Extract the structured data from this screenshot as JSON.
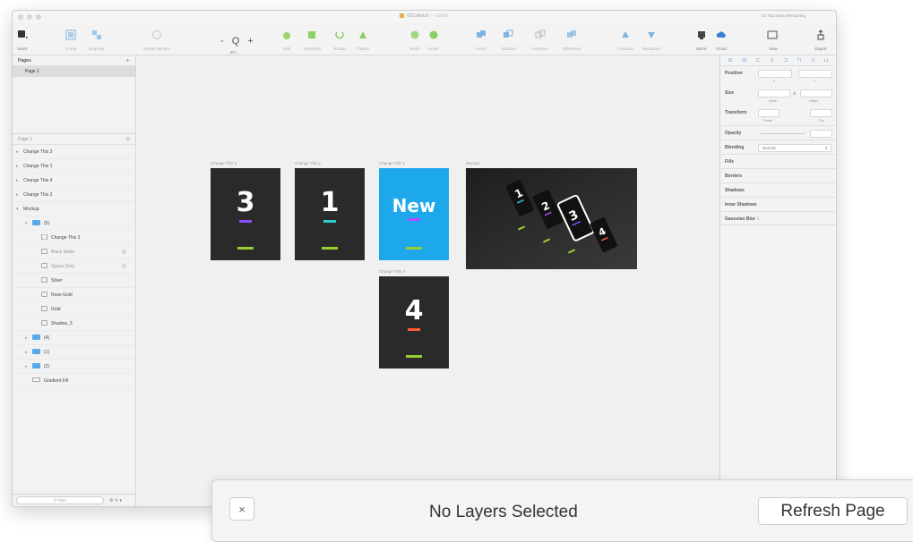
{
  "window": {
    "title": "003.sketch",
    "title_suffix": "— Edited",
    "trial_text": "24 Trial Days Remaining"
  },
  "toolbar": {
    "insert": "Insert",
    "group": "Group",
    "ungroup": "Ungroup",
    "create_symbol": "Create Symbol",
    "zoom_symbol": "- Q +",
    "zoom_value": "8%",
    "edit": "Edit",
    "transform": "Transform",
    "rotate": "Rotate",
    "flatten": "Flatten",
    "mask": "Mask",
    "scale": "Scale",
    "union": "Union",
    "subtract": "Subtract",
    "intersect": "Intersect",
    "difference": "Difference",
    "forward": "Forward",
    "backward": "Backward",
    "mirror": "Mirror",
    "cloud": "Cloud",
    "view": "View",
    "export": "Export"
  },
  "sidebar": {
    "pages_header": "Pages",
    "pages": [
      "Page 1"
    ],
    "layers_header": "Page 1",
    "layers": [
      {
        "name": "Change This 3",
        "arrow": "▸",
        "indent": 0,
        "icon": "none",
        "eye": ""
      },
      {
        "name": "Change This 1",
        "arrow": "▸",
        "indent": 0,
        "icon": "none",
        "eye": ""
      },
      {
        "name": "Change This 4",
        "arrow": "▸",
        "indent": 0,
        "icon": "none",
        "eye": ""
      },
      {
        "name": "Change This 2",
        "arrow": "▸",
        "indent": 0,
        "icon": "none",
        "eye": ""
      },
      {
        "name": "Mockup",
        "arrow": "▾",
        "indent": 0,
        "icon": "none",
        "eye": ""
      },
      {
        "name": "(5)",
        "arrow": "▾",
        "indent": 1,
        "icon": "folder",
        "eye": ""
      },
      {
        "name": "Change This 3",
        "arrow": "",
        "indent": 2,
        "icon": "txt",
        "eye": ""
      },
      {
        "name": "Black Matte",
        "arrow": "",
        "indent": 2,
        "icon": "sym",
        "eye": "◎",
        "muted": true
      },
      {
        "name": "Space Grey",
        "arrow": "",
        "indent": 2,
        "icon": "sym",
        "eye": "◎",
        "muted": true
      },
      {
        "name": "Silver",
        "arrow": "",
        "indent": 2,
        "icon": "sym",
        "eye": ""
      },
      {
        "name": "Rose Gold",
        "arrow": "",
        "indent": 2,
        "icon": "sym",
        "eye": ""
      },
      {
        "name": "Gold",
        "arrow": "",
        "indent": 2,
        "icon": "sym",
        "eye": ""
      },
      {
        "name": "Shadow_3",
        "arrow": "",
        "indent": 2,
        "icon": "sym",
        "eye": ""
      },
      {
        "name": "(4)",
        "arrow": "▸",
        "indent": 1,
        "icon": "folder",
        "eye": ""
      },
      {
        "name": "(1)",
        "arrow": "▸",
        "indent": 1,
        "icon": "folder",
        "eye": ""
      },
      {
        "name": "(2)",
        "arrow": "▸",
        "indent": 1,
        "icon": "folder",
        "eye": ""
      },
      {
        "name": "Gradient Fill",
        "arrow": "",
        "indent": 1,
        "icon": "rect",
        "eye": ""
      }
    ],
    "filter_placeholder": "Filter"
  },
  "canvas": {
    "artboards": [
      {
        "label": "Change This 3",
        "text": "3",
        "bg": "#2a2a2a",
        "accent": "#8a4fff"
      },
      {
        "label": "Change This 1",
        "text": "1",
        "bg": "#2a2a2a",
        "accent": "#2ad0c8"
      },
      {
        "label": "Change This 2",
        "text": "New",
        "bg": "#1da8ec",
        "accent": "#b04dff"
      },
      {
        "label": "Mockup",
        "text": "",
        "bg": "#262626",
        "accent": ""
      },
      {
        "label": "Change This 4",
        "text": "4",
        "bg": "#2a2a2a",
        "accent": "#ff5a36"
      }
    ]
  },
  "inspector": {
    "position": "Position",
    "x": "X",
    "y": "Y",
    "size": "Size",
    "width": "Width",
    "height": "Height",
    "transform": "Transform",
    "rotate": "Rotate",
    "flip": "Flip",
    "opacity": "Opacity",
    "blending": "Blending",
    "blending_value": "Normal",
    "fills": "Fills",
    "borders": "Borders",
    "shadows": "Shadows",
    "inner_shadows": "Inner Shadows",
    "gaussian_blur": "Gaussian Blur"
  },
  "toast": {
    "close": "×",
    "message": "No Layers Selected",
    "refresh": "Refresh Page"
  }
}
